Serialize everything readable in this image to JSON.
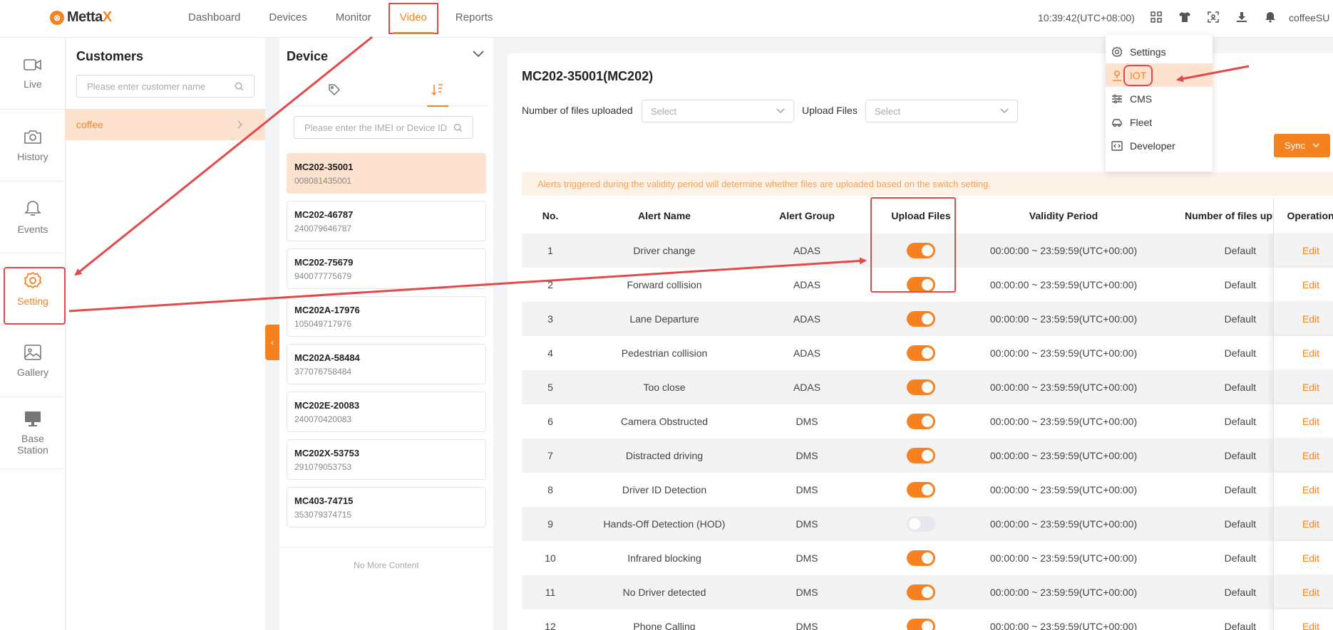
{
  "brand": {
    "logo_text_a": "Metta",
    "logo_text_b": "X",
    "logo_glyph": "⊗"
  },
  "nav": [
    "Dashboard",
    "Devices",
    "Monitor",
    "Video",
    "Reports"
  ],
  "nav_active": "Video",
  "clock": "10:39:42(UTC+08:00)",
  "top_icons": [
    "grid-icon",
    "shirt-icon",
    "scan-icon",
    "download-icon",
    "bell-icon"
  ],
  "user": "coffeeSU",
  "rail": [
    {
      "label": "Live",
      "icon": "video-camera-icon"
    },
    {
      "label": "History",
      "icon": "camera-icon"
    },
    {
      "label": "Events",
      "icon": "bell-icon"
    },
    {
      "label": "Setting",
      "icon": "gear-icon"
    },
    {
      "label": "Gallery",
      "icon": "image-icon"
    },
    {
      "label": "Base Station",
      "icon": "monitor-icon"
    }
  ],
  "customers": {
    "title": "Customers",
    "search_placeholder": "Please enter customer name",
    "items": [
      "coffee"
    ]
  },
  "device": {
    "title": "Device",
    "search_placeholder": "Please enter the IMEI or Device ID",
    "list": [
      {
        "name": "MC202-35001",
        "id": "008081435001"
      },
      {
        "name": "MC202-46787",
        "id": "240079646787"
      },
      {
        "name": "MC202-75679",
        "id": "940077775679"
      },
      {
        "name": "MC202A-17976",
        "id": "105049717976"
      },
      {
        "name": "MC202A-58484",
        "id": "377076758484"
      },
      {
        "name": "MC202E-20083",
        "id": "240070420083"
      },
      {
        "name": "MC202X-53753",
        "id": "291079053753"
      },
      {
        "name": "MC403-74715",
        "id": "353079374715"
      }
    ],
    "no_more": "No More Content"
  },
  "main": {
    "title": "MC202-35001(MC202)",
    "filter1_label": "Number of files uploaded",
    "filter1_value": "Select",
    "filter2_label": "Upload Files",
    "filter2_value": "Select",
    "sync_label": "Sync",
    "notice": "Alerts triggered during the validity period will determine whether files are uploaded based on the switch setting."
  },
  "table": {
    "headers": [
      "No.",
      "Alert Name",
      "Alert Group",
      "Upload Files",
      "Validity Period",
      "Number of files uploaded",
      "Operation"
    ],
    "rows": [
      {
        "no": "1",
        "name": "Driver change",
        "group": "ADAS",
        "on": true,
        "period": "00:00:00 ~ 23:59:59(UTC+00:00)",
        "files": "Default",
        "op": "Edit"
      },
      {
        "no": "2",
        "name": "Forward collision",
        "group": "ADAS",
        "on": true,
        "period": "00:00:00 ~ 23:59:59(UTC+00:00)",
        "files": "Default",
        "op": "Edit"
      },
      {
        "no": "3",
        "name": "Lane Departure",
        "group": "ADAS",
        "on": true,
        "period": "00:00:00 ~ 23:59:59(UTC+00:00)",
        "files": "Default",
        "op": "Edit"
      },
      {
        "no": "4",
        "name": "Pedestrian collision",
        "group": "ADAS",
        "on": true,
        "period": "00:00:00 ~ 23:59:59(UTC+00:00)",
        "files": "Default",
        "op": "Edit"
      },
      {
        "no": "5",
        "name": "Too close",
        "group": "ADAS",
        "on": true,
        "period": "00:00:00 ~ 23:59:59(UTC+00:00)",
        "files": "Default",
        "op": "Edit"
      },
      {
        "no": "6",
        "name": "Camera Obstructed",
        "group": "DMS",
        "on": true,
        "period": "00:00:00 ~ 23:59:59(UTC+00:00)",
        "files": "Default",
        "op": "Edit"
      },
      {
        "no": "7",
        "name": "Distracted driving",
        "group": "DMS",
        "on": true,
        "period": "00:00:00 ~ 23:59:59(UTC+00:00)",
        "files": "Default",
        "op": "Edit"
      },
      {
        "no": "8",
        "name": "Driver ID Detection",
        "group": "DMS",
        "on": true,
        "period": "00:00:00 ~ 23:59:59(UTC+00:00)",
        "files": "Default",
        "op": "Edit"
      },
      {
        "no": "9",
        "name": "Hands-Off Detection (HOD)",
        "group": "DMS",
        "on": false,
        "period": "00:00:00 ~ 23:59:59(UTC+00:00)",
        "files": "Default",
        "op": "Edit"
      },
      {
        "no": "10",
        "name": "Infrared blocking",
        "group": "DMS",
        "on": true,
        "period": "00:00:00 ~ 23:59:59(UTC+00:00)",
        "files": "Default",
        "op": "Edit"
      },
      {
        "no": "11",
        "name": "No Driver detected",
        "group": "DMS",
        "on": true,
        "period": "00:00:00 ~ 23:59:59(UTC+00:00)",
        "files": "Default",
        "op": "Edit"
      },
      {
        "no": "12",
        "name": "Phone Calling",
        "group": "DMS",
        "on": true,
        "period": "00:00:00 ~ 23:59:59(UTC+00:00)",
        "files": "Default",
        "op": "Edit"
      }
    ]
  },
  "dropdown": [
    {
      "label": "Settings",
      "icon": "gear-icon"
    },
    {
      "label": "IOT",
      "icon": "user-pin-icon"
    },
    {
      "label": "CMS",
      "icon": "sliders-icon"
    },
    {
      "label": "Fleet",
      "icon": "car-icon"
    },
    {
      "label": "Developer",
      "icon": "code-icon"
    }
  ],
  "colors": {
    "accent": "#f6821f",
    "highlight": "#e24a4a",
    "active_bg": "#fde2cf"
  }
}
